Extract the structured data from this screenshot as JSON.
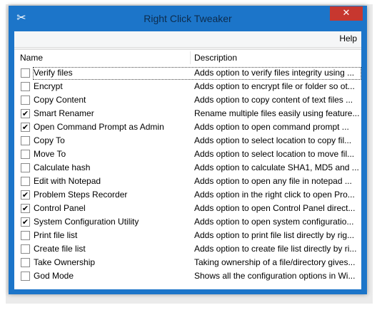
{
  "window": {
    "title": "Right Click Tweaker",
    "close_label": "✕"
  },
  "menu": {
    "help": "Help"
  },
  "columns": {
    "name": "Name",
    "description": "Description"
  },
  "items": [
    {
      "name": "Verify files",
      "description": "Adds option to verify files integrity using ...",
      "checked": false
    },
    {
      "name": "Encrypt",
      "description": "Adds option to encrypt file or folder so ot...",
      "checked": false
    },
    {
      "name": "Copy Content",
      "description": "Adds option to copy content of text files ...",
      "checked": false
    },
    {
      "name": "Smart Renamer",
      "description": "Rename multiple files easily using feature...",
      "checked": true
    },
    {
      "name": "Open Command Prompt as Admin",
      "description": "Adds option to open command prompt ...",
      "checked": true
    },
    {
      "name": "Copy To",
      "description": "Adds option to select location to copy fil...",
      "checked": false
    },
    {
      "name": "Move To",
      "description": "Adds option to select location to move fil...",
      "checked": false
    },
    {
      "name": "Calculate hash",
      "description": "Adds option to calculate SHA1, MD5 and ...",
      "checked": false
    },
    {
      "name": "Edit with Notepad",
      "description": "Adds option to open any file in notepad ...",
      "checked": false
    },
    {
      "name": "Problem Steps Recorder",
      "description": "Adds option in the right click to open Pro...",
      "checked": true
    },
    {
      "name": "Control Panel",
      "description": "Adds option to open Control Panel direct...",
      "checked": true
    },
    {
      "name": "System Configuration Utility",
      "description": "Adds option to open system configuratio...",
      "checked": true
    },
    {
      "name": "Print file list",
      "description": "Adds option to print file list directly by rig...",
      "checked": false
    },
    {
      "name": "Create file list",
      "description": "Adds option to create file list directly by ri...",
      "checked": false
    },
    {
      "name": "Take Ownership",
      "description": "Taking ownership of a file/directory gives...",
      "checked": false
    },
    {
      "name": "God Mode",
      "description": "Shows all the configuration options in Wi...",
      "checked": false
    }
  ]
}
